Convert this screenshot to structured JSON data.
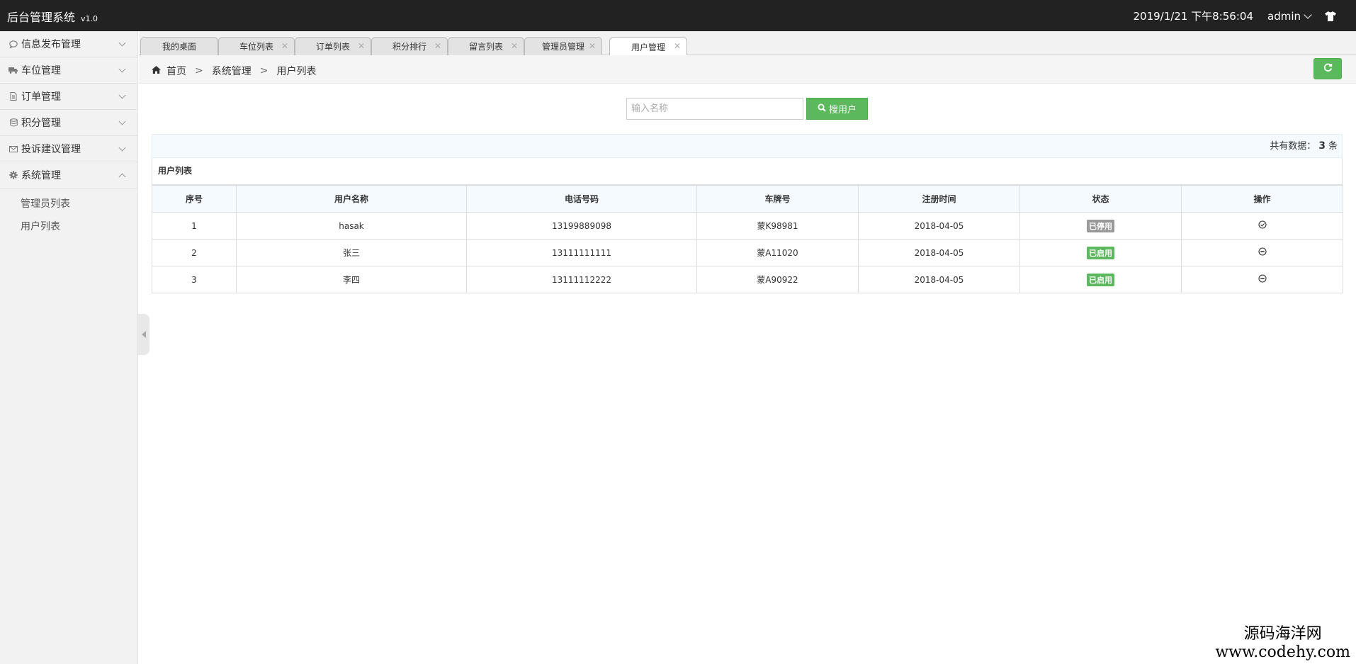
{
  "header": {
    "title": "后台管理系统",
    "version": "v1.0",
    "datetime": "2019/1/21 下午8:56:04",
    "user": "admin"
  },
  "sidebar": {
    "groups": [
      {
        "label": "信息发布管理",
        "icon": "comment-icon"
      },
      {
        "label": "车位管理",
        "icon": "truck-icon"
      },
      {
        "label": "订单管理",
        "icon": "document-icon"
      },
      {
        "label": "积分管理",
        "icon": "database-icon"
      },
      {
        "label": "投诉建议管理",
        "icon": "envelope-icon"
      },
      {
        "label": "系统管理",
        "icon": "gear-icon",
        "expanded": true
      }
    ],
    "sub_items": [
      "管理员列表",
      "用户列表"
    ]
  },
  "tabs": [
    {
      "label": "我的桌面",
      "closable": false
    },
    {
      "label": "车位列表",
      "closable": true
    },
    {
      "label": "订单列表",
      "closable": true
    },
    {
      "label": "积分排行",
      "closable": true
    },
    {
      "label": "留言列表",
      "closable": true
    },
    {
      "label": "管理员管理",
      "closable": true
    },
    {
      "label": "用户管理",
      "closable": true,
      "active": true
    }
  ],
  "breadcrumb": {
    "home": "首页",
    "level1": "系统管理",
    "level2": "用户列表",
    "sep": ">"
  },
  "search": {
    "placeholder": "输入名称",
    "button": "搜用户"
  },
  "count": {
    "prefix": "共有数据：",
    "value": "3",
    "suffix": "条"
  },
  "table": {
    "caption": "用户列表",
    "columns": [
      "序号",
      "用户名称",
      "电话号码",
      "车牌号",
      "注册时间",
      "状态",
      "操作"
    ],
    "rows": [
      {
        "id": "1",
        "name": "hasak",
        "phone": "13199889098",
        "plate": "蒙K98981",
        "date": "2018-04-05",
        "status": "已停用",
        "status_type": "off"
      },
      {
        "id": "2",
        "name": "张三",
        "phone": "13111111111",
        "plate": "蒙A11020",
        "date": "2018-04-05",
        "status": "已启用",
        "status_type": "on"
      },
      {
        "id": "3",
        "name": "李四",
        "phone": "13111112222",
        "plate": "蒙A90922",
        "date": "2018-04-05",
        "status": "已启用",
        "status_type": "on"
      }
    ]
  },
  "watermark": {
    "line1": "源码海洋网",
    "line2": "www.codehy.com"
  },
  "colors": {
    "topbar": "#222222",
    "accent": "#5cb85c",
    "badge_off": "#999999"
  }
}
